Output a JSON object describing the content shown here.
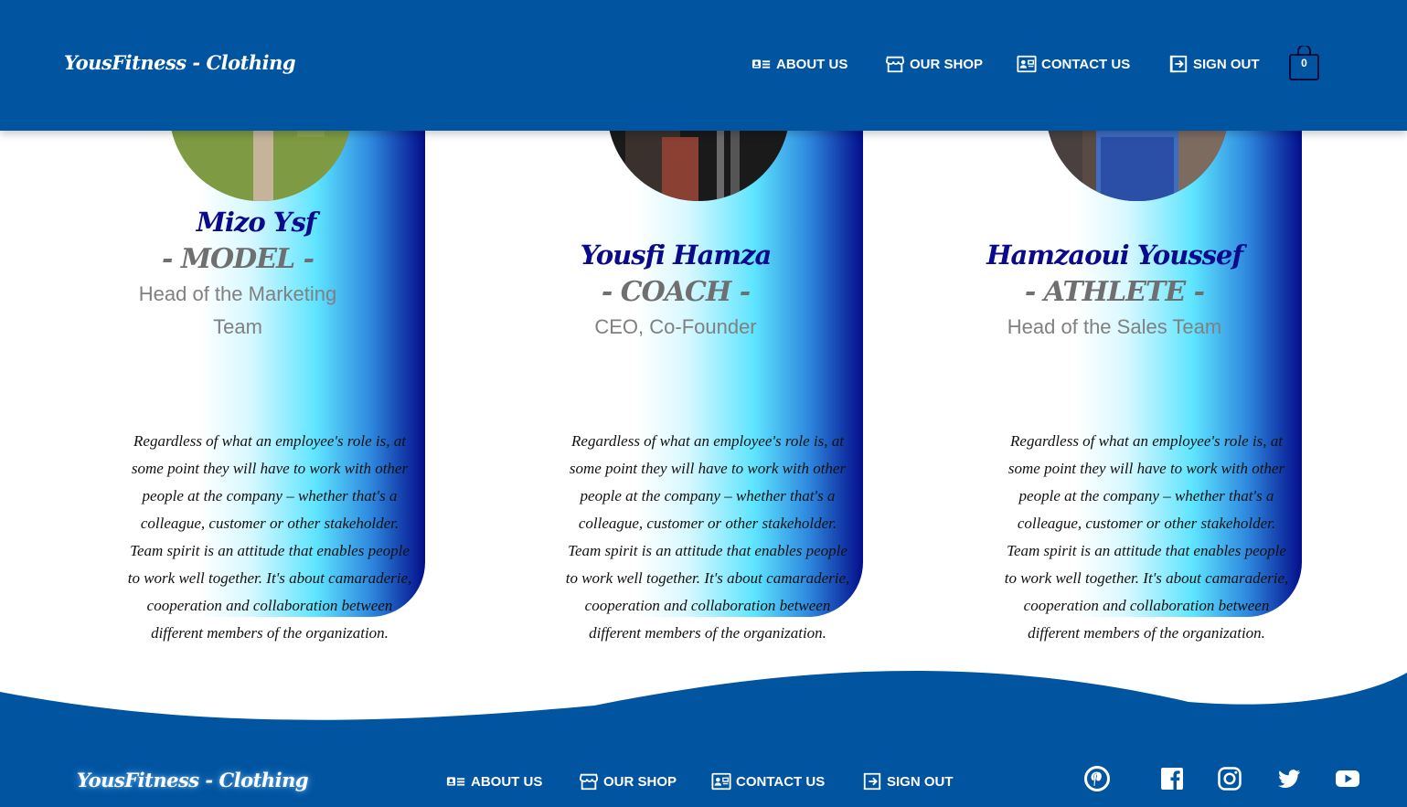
{
  "brand": "YousFitness - Clothing",
  "header": {
    "nav": [
      {
        "label": "ABOUT US",
        "icon": "id-card-icon"
      },
      {
        "label": "OUR SHOP",
        "icon": "store-icon"
      },
      {
        "label": "CONTACT US",
        "icon": "contact-card-icon"
      },
      {
        "label": "SIGN OUT",
        "icon": "sign-out-icon"
      }
    ],
    "cart_count": "0"
  },
  "team": [
    {
      "name": "Mizo Ysf",
      "role": "- MODEL -",
      "subtitle_line1": "Head of the Marketing",
      "subtitle_line2": "Team",
      "description": "Regardless of what an employee's role is, at some point they will have to work with other people at the company – whether that's a colleague, customer or other stakeholder. Team spirit is an attitude that enables people to work well together. It's about camaraderie, cooperation and collaboration between different members of the organization."
    },
    {
      "name": "Yousfi Hamza",
      "role": "- COACH -",
      "subtitle_line1": "CEO, Co-Founder",
      "subtitle_line2": "",
      "description": "Regardless of what an employee's role is, at some point they will have to work with other people at the company – whether that's a colleague, customer or other stakeholder. Team spirit is an attitude that enables people to work well together. It's about camaraderie, cooperation and collaboration between different members of the organization."
    },
    {
      "name": "Hamzaoui Youssef",
      "role": "- ATHLETE -",
      "subtitle_line1": "Head of the Sales Team",
      "subtitle_line2": "",
      "description": "Regardless of what an employee's role is, at some point they will have to work with other people at the company – whether that's a colleague, customer or other stakeholder. Team spirit is an attitude that enables people to work well together. It's about camaraderie, cooperation and collaboration between different members of the organization."
    }
  ],
  "footer": {
    "nav": [
      {
        "label": "ABOUT US",
        "icon": "id-card-icon"
      },
      {
        "label": "OUR SHOP",
        "icon": "store-icon"
      },
      {
        "label": "CONTACT US",
        "icon": "contact-card-icon"
      },
      {
        "label": "SIGN OUT",
        "icon": "sign-out-icon"
      }
    ],
    "social": [
      "pinterest-icon",
      "facebook-icon",
      "instagram-icon",
      "twitter-icon",
      "youtube-icon"
    ]
  },
  "colors": {
    "primary": "#01549f",
    "name": "#0a0a8a",
    "role": "#6f6f6f",
    "card_dark": "#030e8b",
    "card_light": "#5ee4ff"
  }
}
